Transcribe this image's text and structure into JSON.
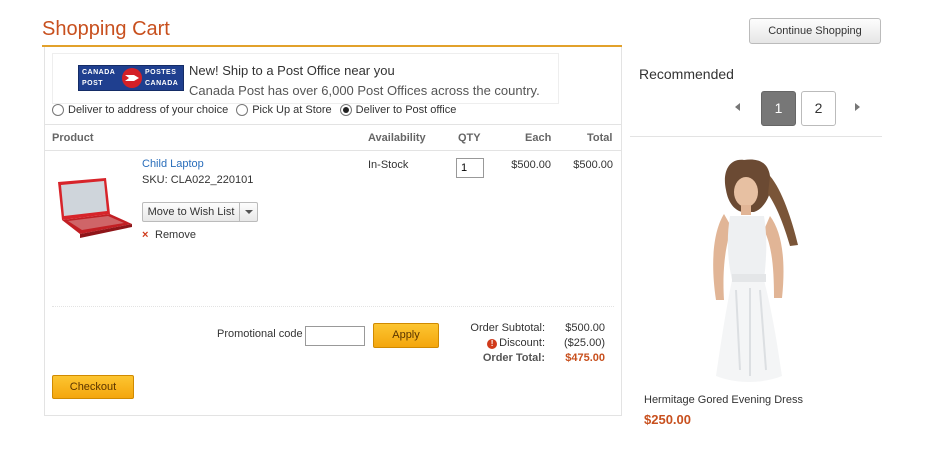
{
  "page": {
    "title": "Shopping Cart",
    "continue_label": "Continue Shopping"
  },
  "banner": {
    "logo": {
      "line1_left": "CANADA",
      "line1_right": "POSTES",
      "line2_left": "POST",
      "line2_right": "CANADA"
    },
    "headline": "New! Ship to a Post Office near you",
    "subline": "Canada Post has over 6,000 Post Offices across the country."
  },
  "shipping_options": [
    {
      "label": "Deliver to address of your choice",
      "selected": false
    },
    {
      "label": "Pick Up at Store",
      "selected": false
    },
    {
      "label": "Deliver to Post office",
      "selected": true
    }
  ],
  "table": {
    "headers": {
      "product": "Product",
      "availability": "Availability",
      "qty": "QTY",
      "each": "Each",
      "total": "Total"
    }
  },
  "item": {
    "name": "Child Laptop",
    "sku": "SKU: CLA022_220101",
    "availability": "In-Stock",
    "qty": "1",
    "each": "$500.00",
    "total": "$500.00",
    "wish_label": "Move to Wish List",
    "remove_label": "Remove",
    "remove_glyph": "×",
    "image_icon": "laptop-red"
  },
  "promo": {
    "label": "Promotional code",
    "value": "",
    "apply_label": "Apply"
  },
  "summary": {
    "subtotal_label": "Order Subtotal:",
    "subtotal_value": "$500.00",
    "discount_label": "Discount:",
    "discount_value": "($25.00)",
    "discount_icon": "!",
    "total_label": "Order Total:",
    "total_value": "$475.00"
  },
  "checkout_label": "Checkout",
  "recommended": {
    "title": "Recommended",
    "pages": [
      "1",
      "2"
    ],
    "active_page": "1",
    "product_name": "Hermitage Gored Evening Dress",
    "product_price": "$250.00",
    "image_icon": "woman-in-white-dress"
  },
  "colors": {
    "accent": "#c8501e",
    "button": "#f4a60d",
    "link": "#2a6ebb"
  }
}
